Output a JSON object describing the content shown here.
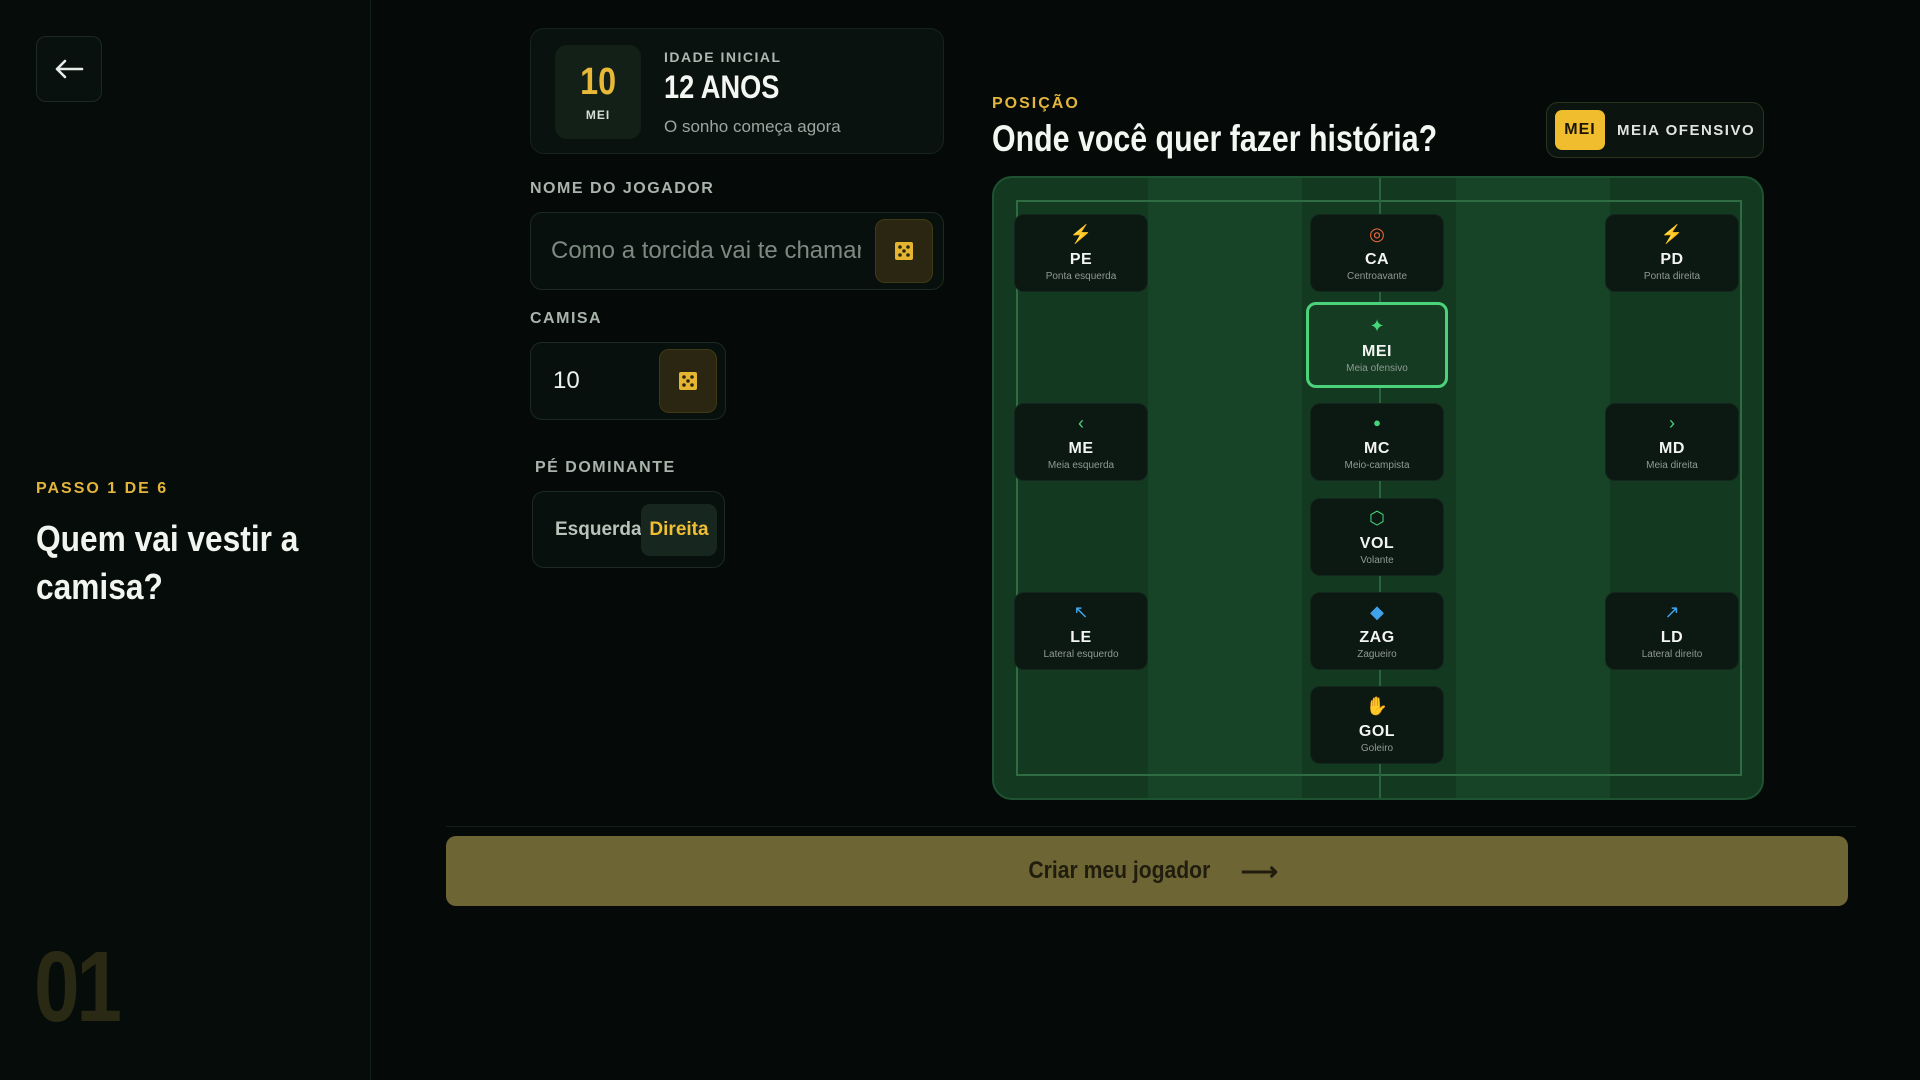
{
  "step": {
    "label": "PASSO 1 DE 6",
    "title": "Quem vai vestir a camisa?",
    "number": "01"
  },
  "age_card": {
    "badge_number": "10",
    "badge_position": "MEI",
    "kicker": "IDADE INICIAL",
    "value": "12 ANOS",
    "subtitle": "O sonho começa agora"
  },
  "form": {
    "name_label": "NOME DO JOGADOR",
    "name_value": "",
    "name_placeholder": "Como a torcida vai te chamar?",
    "jersey_label": "CAMISA",
    "jersey_value": "10",
    "foot_label": "PÉ DOMINANTE",
    "foot_options": [
      "Esquerda",
      "Direita"
    ],
    "foot_selected": "Direita"
  },
  "position": {
    "kicker": "POSIÇÃO",
    "title": "Onde você quer fazer história?",
    "selected_code": "MEI",
    "selected_name": "MEIA OFENSIVO",
    "cards": [
      {
        "code": "PE",
        "desc": "Ponta esquerda",
        "icon": "⚡",
        "icon_name": "lightning-icon",
        "icon_color": "#f26a3c"
      },
      {
        "code": "CA",
        "desc": "Centroavante",
        "icon": "◎",
        "icon_name": "target-icon",
        "icon_color": "#f26a3c"
      },
      {
        "code": "PD",
        "desc": "Ponta direita",
        "icon": "⚡",
        "icon_name": "lightning-icon",
        "icon_color": "#f26a3c"
      },
      {
        "code": "MEI",
        "desc": "Meia ofensivo",
        "icon": "✦",
        "icon_name": "sparkle-icon",
        "icon_color": "#45d67c"
      },
      {
        "code": "ME",
        "desc": "Meia esquerda",
        "icon": "‹",
        "icon_name": "chevron-left-icon",
        "icon_color": "#45d67c"
      },
      {
        "code": "MC",
        "desc": "Meio-campista",
        "icon": "●",
        "icon_name": "dot-icon",
        "icon_color": "#45d67c"
      },
      {
        "code": "MD",
        "desc": "Meia direita",
        "icon": "›",
        "icon_name": "chevron-right-icon",
        "icon_color": "#45d67c"
      },
      {
        "code": "VOL",
        "desc": "Volante",
        "icon": "⬡",
        "icon_name": "hexagon-icon",
        "icon_color": "#45d67c"
      },
      {
        "code": "LE",
        "desc": "Lateral esquerdo",
        "icon": "↖",
        "icon_name": "arrow-up-left-icon",
        "icon_color": "#3ea3ea"
      },
      {
        "code": "ZAG",
        "desc": "Zagueiro",
        "icon": "◆",
        "icon_name": "diamond-icon",
        "icon_color": "#3ea3ea"
      },
      {
        "code": "LD",
        "desc": "Lateral direito",
        "icon": "↗",
        "icon_name": "arrow-up-right-icon",
        "icon_color": "#3ea3ea"
      },
      {
        "code": "GOL",
        "desc": "Goleiro",
        "icon": "✋",
        "icon_name": "glove-icon",
        "icon_color": "#b46ae8"
      }
    ]
  },
  "cta": {
    "label": "Criar meu jogador",
    "arrow": "⟶"
  },
  "colors": {
    "accent_gold": "#e3b53c",
    "selected_green": "#4bd27a",
    "background": "#050a08"
  }
}
